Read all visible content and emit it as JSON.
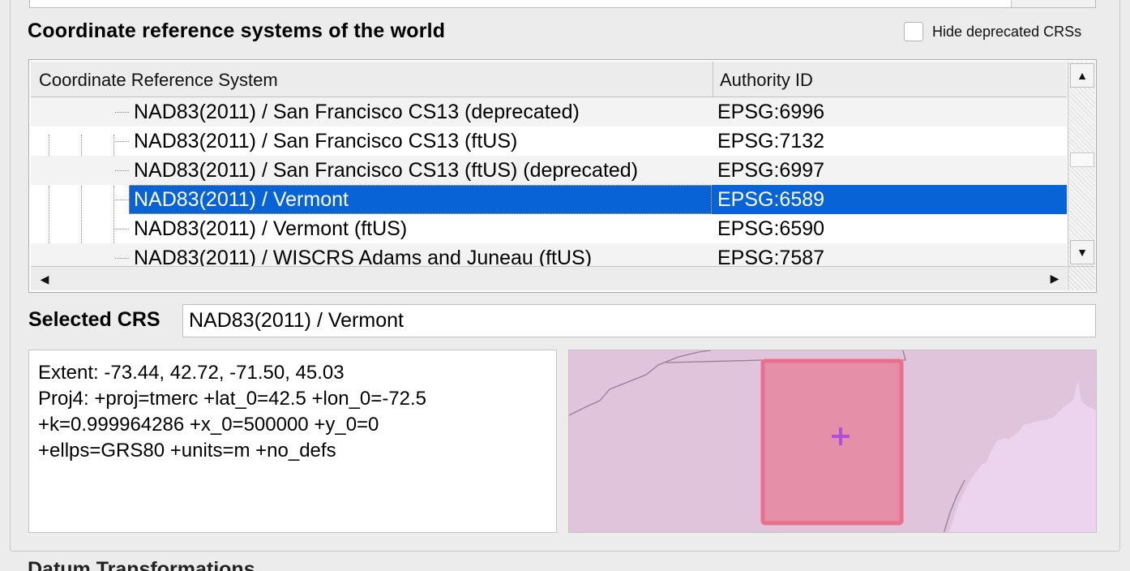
{
  "section": {
    "title": "Coordinate reference systems of the world",
    "hide_deprecated_label": "Hide deprecated CRSs",
    "hide_deprecated_checked": false
  },
  "table": {
    "columns": [
      "Coordinate Reference System",
      "Authority ID"
    ],
    "rows": [
      {
        "name": "NAD83(2011) / San Francisco CS13 (deprecated)",
        "authority": "EPSG:6996"
      },
      {
        "name": "NAD83(2011) / San Francisco CS13 (ftUS)",
        "authority": "EPSG:7132"
      },
      {
        "name": "NAD83(2011) / San Francisco CS13 (ftUS) (deprecated)",
        "authority": "EPSG:6997"
      },
      {
        "name": "NAD83(2011) / Vermont",
        "authority": "EPSG:6589",
        "selected": true
      },
      {
        "name": "NAD83(2011) / Vermont (ftUS)",
        "authority": "EPSG:6590"
      },
      {
        "name": "NAD83(2011) / WISCRS Adams and Juneau (ftUS)",
        "authority": "EPSG:7587"
      }
    ]
  },
  "selected_crs": {
    "label": "Selected CRS",
    "value": "NAD83(2011) / Vermont"
  },
  "info": {
    "lines": [
      "Extent: -73.44, 42.72, -71.50, 45.03",
      "Proj4: +proj=tmerc +lat_0=42.5 +lon_0=-72.5",
      "+k=0.999964286 +x_0=500000 +y_0=0",
      "+ellps=GRS80 +units=m +no_defs"
    ]
  },
  "map": {
    "land_color": "#dfc4dc",
    "neighbor_color": "#ecd3ee",
    "extent_fill": "#e68fa8",
    "extent_stroke": "#e8708e",
    "center_marker_color": "#b050d8"
  },
  "next_section": {
    "title": "Datum Transformations"
  },
  "colors": {
    "selection": "#0863d7",
    "background": "#ececec"
  }
}
